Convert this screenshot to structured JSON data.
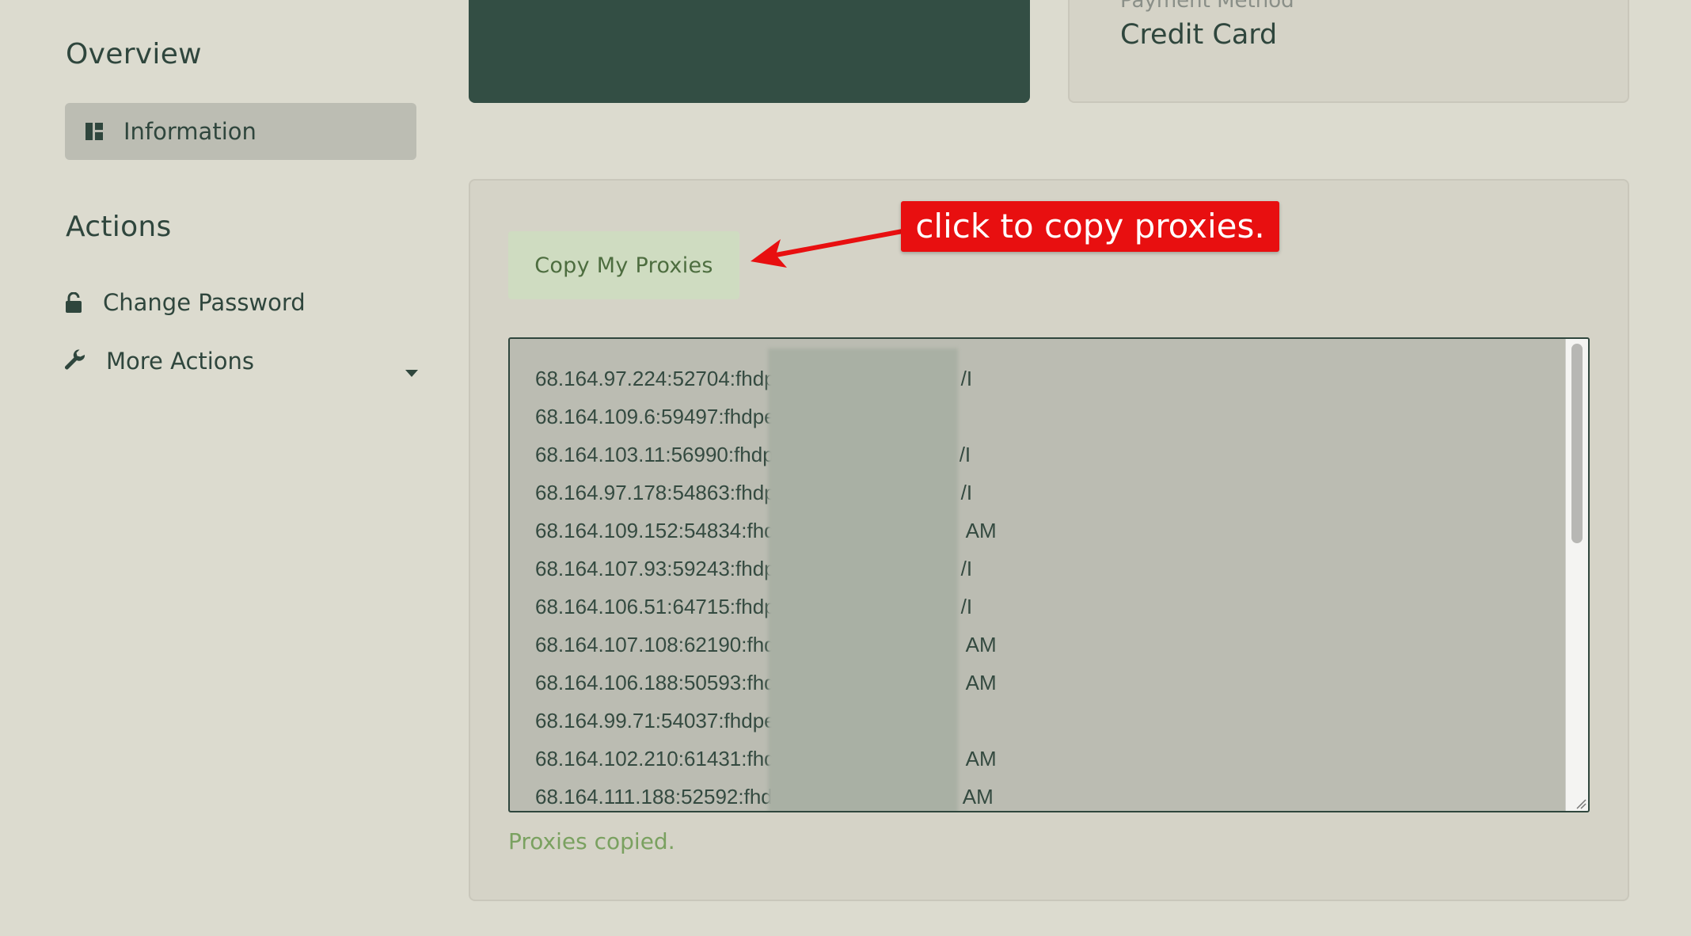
{
  "sidebar": {
    "overview_heading": "Overview",
    "overview_items": [
      {
        "label": "Information",
        "icon": "dashboard-icon",
        "active": true
      }
    ],
    "actions_heading": "Actions",
    "action_items": [
      {
        "label": "Change Password",
        "icon": "lock-icon"
      },
      {
        "label": "More Actions",
        "icon": "wrench-icon",
        "has_dropdown": true
      }
    ]
  },
  "payment_card": {
    "label": "Payment Method",
    "value": "Credit Card"
  },
  "proxies": {
    "copy_button_label": "Copy My Proxies",
    "list": [
      "68.164.97.224:52704:fhdp",
      "68.164.109.6:59497:fhdpe",
      "68.164.103.11:56990:fhdp",
      "68.164.97.178:54863:fhdp",
      "68.164.109.152:54834:fhd",
      "68.164.107.93:59243:fhdp",
      "68.164.106.51:64715:fhdp",
      "68.164.107.108:62190:fhd",
      "68.164.106.188:50593:fhd",
      "68.164.99.71:54037:fhdpe",
      "68.164.102.210:61431:fhd",
      "68.164.111.188:52592:fhd"
    ],
    "visible_suffixes": [
      "/I",
      "",
      "/I",
      "/I",
      "AM",
      "/I",
      "/I",
      "AM",
      "AM",
      "",
      "AM",
      "AM"
    ],
    "status_text": "Proxies copied."
  },
  "annotation": {
    "text": "click to copy proxies."
  },
  "colors": {
    "background": "#dcdbcf",
    "dark_card": "#334e44",
    "active_nav": "#bcbdb3",
    "copy_button_bg": "#cfdcc1",
    "status_green": "#7aa160",
    "annotation_red": "#e80f10"
  }
}
